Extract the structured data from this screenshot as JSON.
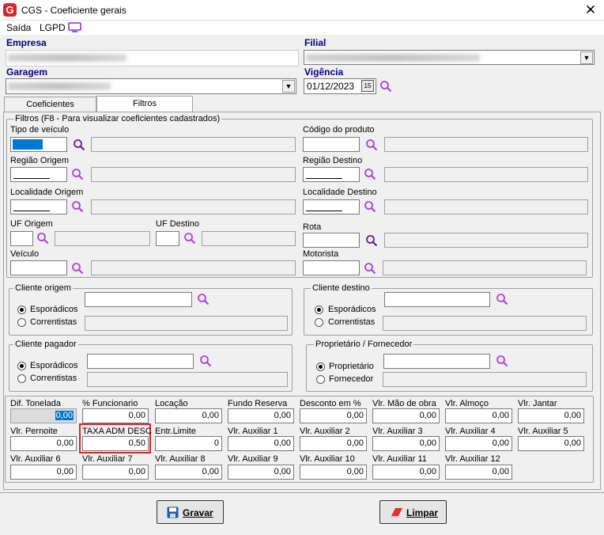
{
  "window": {
    "title": "CGS - Coeficiente gerais",
    "close": "✕"
  },
  "menu": {
    "saida": "Saída",
    "lgpd": "LGPD"
  },
  "header": {
    "empresa_label": "Empresa",
    "filial_label": "Filial",
    "garagem_label": "Garagem",
    "vigencia_label": "Vigência",
    "vigencia_value": "01/12/2023"
  },
  "tabs": {
    "coeficientes": "Coeficientes",
    "filtros": "Filtros"
  },
  "filtros": {
    "group_label": "Filtros (F8 - Para visualizar coeficientes cadastrados)",
    "tipo_veiculo": "Tipo de veículo",
    "codigo_produto": "Código do produto",
    "regiao_origem": "Região Origem",
    "regiao_destino": "Região Destino",
    "localidade_origem": "Localidade Origem",
    "localidade_destino": "Localidade Destino",
    "uf_origem": "UF Origem",
    "uf_destino": "UF Destino",
    "rota": "Rota",
    "veiculo": "Veículo",
    "motorista": "Motorista"
  },
  "clientes": {
    "cliente_origem": "Cliente origem",
    "cliente_destino": "Cliente destino",
    "cliente_pagador": "Cliente pagador",
    "proprietario": "Proprietário / Fornecedor",
    "esporadicos": "Esporádicos",
    "correntistas": "Correntistas",
    "proprietario_opt": "Proprietário",
    "fornecedor_opt": "Fornecedor"
  },
  "valores": {
    "row1": [
      {
        "label": "Dif. Tonelada",
        "value": "0,00"
      },
      {
        "label": "% Funcionario",
        "value": "0,00"
      },
      {
        "label": "Locação",
        "value": "0,00"
      },
      {
        "label": "Fundo Reserva",
        "value": "0,00"
      },
      {
        "label": "Desconto em %",
        "value": "0,00"
      },
      {
        "label": "Vlr. Mão de obra",
        "value": "0,00"
      },
      {
        "label": "Vlr. Almoço",
        "value": "0,00"
      },
      {
        "label": "Vlr. Jantar",
        "value": "0,00"
      }
    ],
    "row2": [
      {
        "label": "Vlr. Pernoite",
        "value": "0,00"
      },
      {
        "label": "TAXA ADM DESC",
        "value": "0,50"
      },
      {
        "label": "Entr.Limite",
        "value": "0"
      },
      {
        "label": "Vlr. Auxiliar 1",
        "value": "0,00"
      },
      {
        "label": "Vlr. Auxiliar 2",
        "value": "0,00"
      },
      {
        "label": "Vlr. Auxiliar 3",
        "value": "0,00"
      },
      {
        "label": "Vlr. Auxiliar 4",
        "value": "0,00"
      },
      {
        "label": "Vlr. Auxiliar 5",
        "value": "0,00"
      }
    ],
    "row3": [
      {
        "label": "Vlr. Auxiliar 6",
        "value": "0,00"
      },
      {
        "label": "Vlr. Auxiliar 7",
        "value": "0,00"
      },
      {
        "label": "Vlr. Auxiliar 8",
        "value": "0,00"
      },
      {
        "label": "Vlr. Auxiliar 9",
        "value": "0,00"
      },
      {
        "label": "Vlr. Auxiliar 10",
        "value": "0,00"
      },
      {
        "label": "Vlr. Auxiliar 11",
        "value": "0,00"
      },
      {
        "label": "Vlr. Auxiliar 12",
        "value": "0,00"
      }
    ]
  },
  "buttons": {
    "gravar": "Gravar",
    "limpar": "Limpar"
  },
  "colors": {
    "accent": "#000080",
    "highlight": "#d9262c",
    "magnifier": "#8a2be2"
  }
}
